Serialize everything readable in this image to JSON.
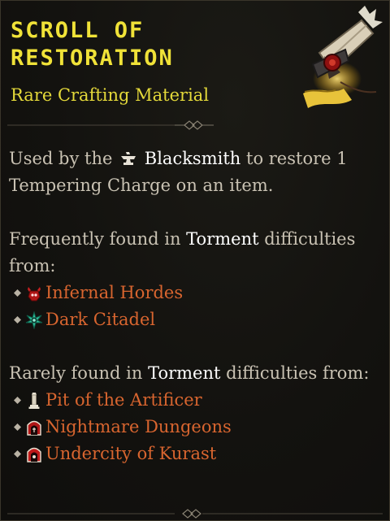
{
  "item": {
    "title_line1": "SCROLL OF",
    "title_line2": "RESTORATION",
    "rarity_type": "Rare Crafting Material"
  },
  "description": {
    "prefix": "Used by  the",
    "vendor_icon": "anvil-icon",
    "vendor": "Blacksmith",
    "suffix": "to restore 1 Tempering Charge on an item."
  },
  "frequent": {
    "prefix": "Frequently found in",
    "difficulty": "Torment",
    "suffix": "difficulties from:",
    "sources": [
      {
        "label": "Infernal Hordes",
        "icon": "infernal-hordes-icon"
      },
      {
        "label": "Dark Citadel",
        "icon": "dark-citadel-icon"
      }
    ]
  },
  "rare": {
    "prefix": "Rarely found in",
    "difficulty": "Torment",
    "suffix": "difficulties from:",
    "sources": [
      {
        "label": "Pit of the Artificer",
        "icon": "obelisk-icon"
      },
      {
        "label": "Nightmare Dungeons",
        "icon": "nightmare-dungeon-icon"
      },
      {
        "label": "Undercity of Kurast",
        "icon": "undercity-icon"
      }
    ]
  },
  "colors": {
    "title": "#f0e238",
    "rarity": "#e4d93a",
    "body_text": "#c9c2b3",
    "highlight": "#ffffff",
    "location": "#d8652f",
    "background": "#13120f"
  }
}
